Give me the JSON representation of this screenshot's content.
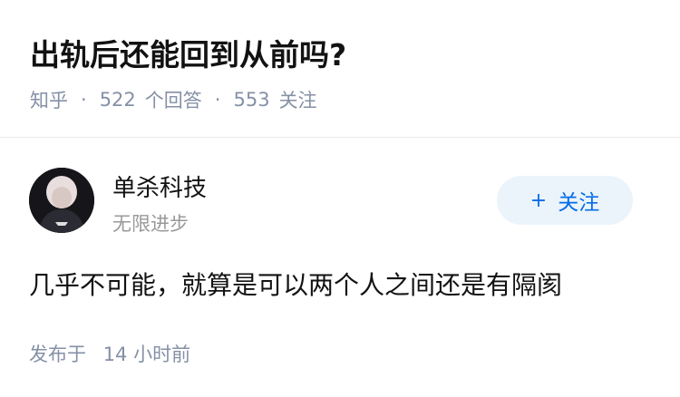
{
  "question": {
    "title": "出轨后还能回到从前吗?",
    "source": "知乎",
    "answer_count": "522",
    "answer_label": "个回答",
    "follow_count": "553",
    "follow_label": "关注"
  },
  "answer": {
    "author_name": "单杀科技",
    "author_bio": "无限进步",
    "follow_button": "关注",
    "follow_icon": "plus-icon",
    "content": "几乎不可能，就算是可以两个人之间还是有隔阂",
    "time_label": "发布于",
    "time_value": "14 小时前"
  },
  "colors": {
    "meta_gray": "#8590a6",
    "follow_blue": "#056de8",
    "follow_bg": "#ebf3fb"
  }
}
